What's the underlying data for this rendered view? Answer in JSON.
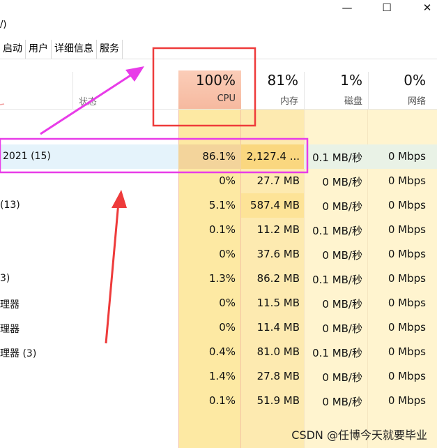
{
  "window": {
    "title_fragment": "/)",
    "buttons": {
      "minimize": "—",
      "maximize": "☐",
      "close": "✕"
    }
  },
  "tabs": [
    "启动",
    "用户",
    "详细信息",
    "服务"
  ],
  "header": {
    "status_label": "状态",
    "columns": [
      {
        "pct": "100%",
        "name": "CPU"
      },
      {
        "pct": "81%",
        "name": "内存"
      },
      {
        "pct": "1%",
        "name": "磁盘"
      },
      {
        "pct": "0%",
        "name": "网络"
      }
    ]
  },
  "rows": [
    {
      "name": "2021 (15)",
      "cpu": "86.1%",
      "mem": "2,127.4 ...",
      "disk": "0.1 MB/秒",
      "net": "0 Mbps"
    },
    {
      "name": "",
      "cpu": "0%",
      "mem": "27.7 MB",
      "disk": "0 MB/秒",
      "net": "0 Mbps"
    },
    {
      "name": "(13)",
      "cpu": "5.1%",
      "mem": "587.4 MB",
      "disk": "0 MB/秒",
      "net": "0 Mbps"
    },
    {
      "name": "",
      "cpu": "0.1%",
      "mem": "11.2 MB",
      "disk": "0.1 MB/秒",
      "net": "0 Mbps"
    },
    {
      "name": "",
      "cpu": "0%",
      "mem": "37.6 MB",
      "disk": "0 MB/秒",
      "net": "0 Mbps"
    },
    {
      "name": "3)",
      "cpu": "1.3%",
      "mem": "86.2 MB",
      "disk": "0.1 MB/秒",
      "net": "0 Mbps"
    },
    {
      "name": "理器",
      "cpu": "0%",
      "mem": "11.5 MB",
      "disk": "0 MB/秒",
      "net": "0 Mbps"
    },
    {
      "name": "理器",
      "cpu": "0%",
      "mem": "11.4 MB",
      "disk": "0 MB/秒",
      "net": "0 Mbps"
    },
    {
      "name": "理器 (3)",
      "cpu": "0.4%",
      "mem": "81.0 MB",
      "disk": "0.1 MB/秒",
      "net": "0 Mbps"
    },
    {
      "name": "",
      "cpu": "1.4%",
      "mem": "27.8 MB",
      "disk": "0 MB/秒",
      "net": "0 Mbps"
    },
    {
      "name": "",
      "cpu": "0.1%",
      "mem": "51.9 MB",
      "disk": "0 MB/秒",
      "net": "0 Mbps"
    }
  ],
  "watermark": "CSDN @任博今天就要毕业",
  "colors": {
    "cpu_header": "#f6b99f",
    "cpu_cell": "#fde9a3",
    "cpu_cell_hot": "#f3d49b",
    "mem_cell": "#fdeab0",
    "mem_cell_hot": "#fde397",
    "light_cell": "#fff4cf",
    "selected_row": "#e5f3fb",
    "annotation_red": "#ee3b3b",
    "annotation_magenta": "#e83ce8"
  }
}
